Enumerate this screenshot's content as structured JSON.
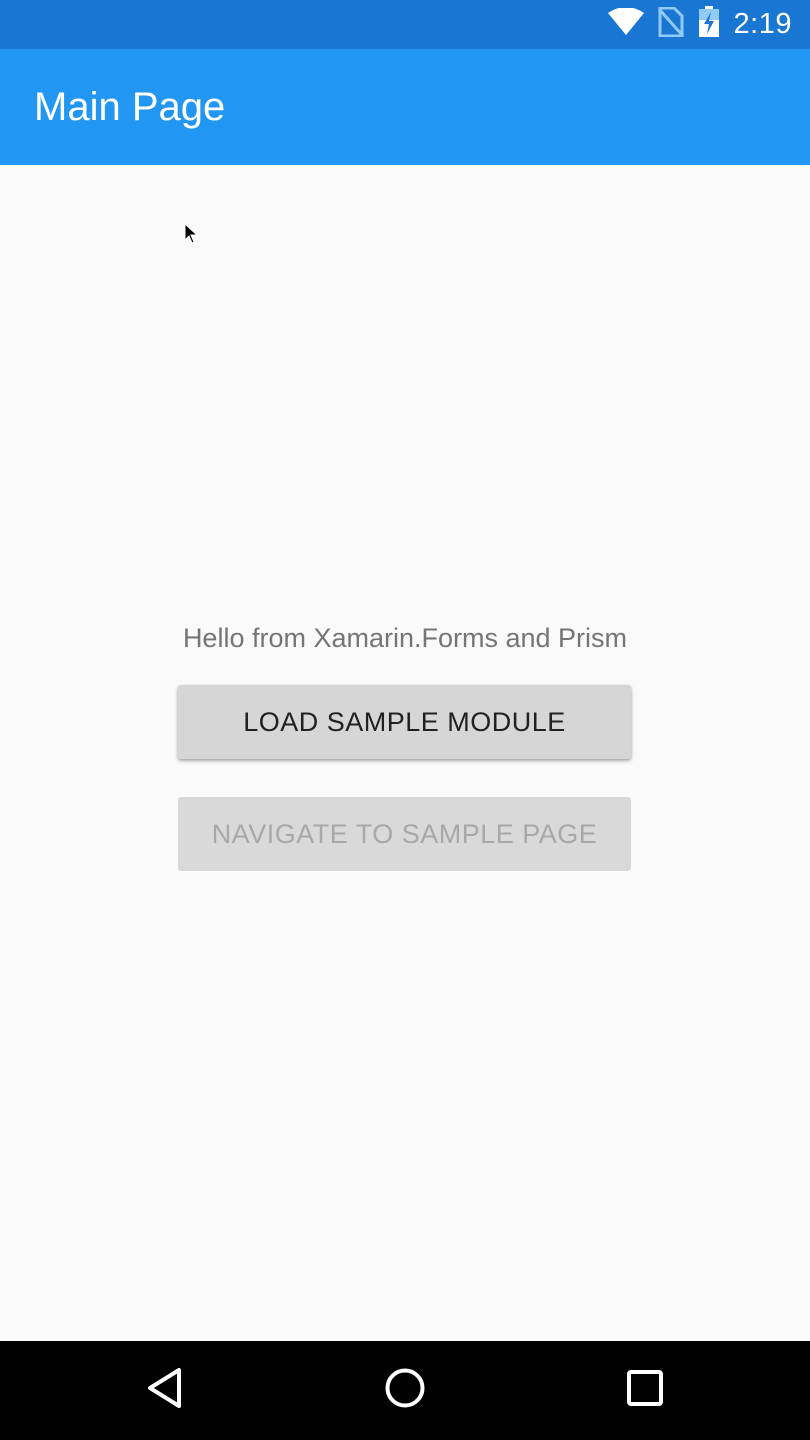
{
  "status_bar": {
    "time": "2:19",
    "icons": [
      "wifi-icon",
      "no-sim-icon",
      "battery-charging-icon"
    ],
    "background": "#1976d2"
  },
  "app_bar": {
    "title": "Main Page",
    "background": "#2196f3"
  },
  "main": {
    "greeting": "Hello from Xamarin.Forms and Prism",
    "load_button_label": "LOAD SAMPLE MODULE",
    "navigate_button_label": "NAVIGATE TO SAMPLE PAGE",
    "navigate_button_enabled": false
  },
  "nav_bar": {
    "buttons": [
      "back-icon",
      "home-icon",
      "recent-apps-icon"
    ]
  }
}
